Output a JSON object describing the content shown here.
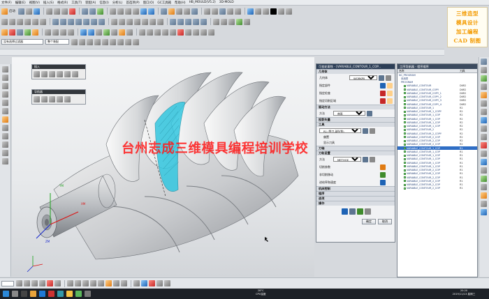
{
  "menus": [
    "文件(F)",
    "编辑(E)",
    "视图(V)",
    "插入(S)",
    "格式(R)",
    "工具(T)",
    "装配(A)",
    "信息(I)",
    "分析(L)",
    "首选项(P)",
    "窗口(O)",
    "GC工具箱",
    "帮助(H)",
    "HB_MOULD(V5.2)",
    "3D-MOLD"
  ],
  "toolbar": {
    "start_label": "启动",
    "filter_label": "没有选择过滤器",
    "assembly_combo": "整个装配"
  },
  "banner": {
    "line1": "三维造型",
    "line2": "模具设计",
    "line3": "加工编程",
    "line4": "CAD 制图"
  },
  "panels": {
    "insert": "插入",
    "navigator": "导航器"
  },
  "watermark": "台州志成三维模具编程培训学校",
  "csys": {
    "x_label": "XM",
    "y_label": "YM",
    "z_label": "ZM"
  },
  "dialog": {
    "title": "可变轮廓铣 - [VARIABLE_CONTOUR_1_COP...",
    "sec_geometry": "几何体",
    "geometry_label": "几何体",
    "geometry_value": "WORKPIECE",
    "part_label": "指定部件",
    "check_label": "指定检查",
    "cut_area_label": "指定切削区域",
    "sec_drive": "驱动方法",
    "method_label": "方法",
    "method_value": "曲面",
    "sec_projection": "投影矢量",
    "sec_tool": "工具",
    "tool_value": "R1 (铣刀-球头铣)",
    "offset_label": "偏置",
    "display_label": "显示刀具",
    "sec_axis": "刀轴",
    "sec_path": "刀轨设置",
    "path_method_label": "方法",
    "path_method_value": "METHOD",
    "cut_param_label": "切削参数",
    "non_cut_label": "非切削移动",
    "feed_label": "进给率和速度",
    "sec_machine": "机床控制",
    "sec_program": "程序",
    "sec_options": "选项",
    "sec_actions": "操作",
    "ok_label": "确定",
    "cancel_label": "取消"
  },
  "navigator": {
    "title": "工序导航器 - 程序顺序",
    "col_name": "名称",
    "col_tool": "刀具",
    "rows": [
      {
        "name": "NC_PROGRAM",
        "tool": ""
      },
      {
        "name": "未用项",
        "tool": ""
      },
      {
        "name": "PROGRAM",
        "tool": ""
      },
      {
        "name": "VARIABLE_CONTOUR",
        "tool": "D6R2"
      },
      {
        "name": "VARIABLE_CONTOUR_COPY",
        "tool": "D6R2"
      },
      {
        "name": "VARIABLE_CONTOUR_COPY_1",
        "tool": "D6R2"
      },
      {
        "name": "VARIABLE_CONTOUR_COPY_2",
        "tool": "D6R2"
      },
      {
        "name": "VARIABLE_CONTOUR_COPY_3",
        "tool": "D6R2"
      },
      {
        "name": "VARIABLE_CONTOUR_COPY_4",
        "tool": "D6R2"
      },
      {
        "name": "VARIABLE_CONTOUR_1",
        "tool": "R2"
      },
      {
        "name": "VARIABLE_CONTOUR_1_COPY",
        "tool": "R2"
      },
      {
        "name": "VARIABLE_CONTOUR_1_COP",
        "tool": "R2"
      },
      {
        "name": "VARIABLE_CONTOUR_1_COP",
        "tool": "R2"
      },
      {
        "name": "VARIABLE_CONTOUR_1_COP",
        "tool": "R2"
      },
      {
        "name": "VARIABLE_CONTOUR_1_COP",
        "tool": "R2"
      },
      {
        "name": "VARIABLE_CONTOUR_2",
        "tool": "R2"
      },
      {
        "name": "VARIABLE_CONTOUR_2_COPY",
        "tool": "R2"
      },
      {
        "name": "VARIABLE_CONTOUR_2_COP",
        "tool": "R2"
      },
      {
        "name": "VARIABLE_CONTOUR_2_COP",
        "tool": "R2"
      },
      {
        "name": "VARIABLE_CONTOUR_2_COP",
        "tool": "R2"
      },
      {
        "name": "VARIABLE_CONTOUR_1_COP",
        "tool": "R1"
      },
      {
        "name": "VARIABLE_CONTOUR_1_COP",
        "tool": "R1"
      },
      {
        "name": "VARIABLE_CONTOUR_1_COP",
        "tool": "R1"
      },
      {
        "name": "VARIABLE_CONTOUR_1_COP",
        "tool": "R1"
      },
      {
        "name": "VARIABLE_CONTOUR_1_COP",
        "tool": "R1"
      },
      {
        "name": "VARIABLE_CONTOUR_1_COP",
        "tool": "R1"
      },
      {
        "name": "VARIABLE_CONTOUR_2_COP",
        "tool": "R1"
      },
      {
        "name": "VARIABLE_CONTOUR_2_COP",
        "tool": "R1"
      },
      {
        "name": "VARIABLE_CONTOUR_2_COP",
        "tool": "R1"
      },
      {
        "name": "VARIABLE_CONTOUR_2_COP",
        "tool": "R1"
      },
      {
        "name": "VARIABLE_CONTOUR_2_COP",
        "tool": "R1"
      },
      {
        "name": "VARIABLE_CONTOUR_2_COP",
        "tool": "R1"
      }
    ]
  },
  "taskbar": {
    "weather": "28°C",
    "cpu_label": "CPU温度",
    "time": "20:20",
    "date": "2019/11/13 星期三"
  },
  "colors": {
    "accent": "#2f6ec5",
    "watermark": "#ff1d1d",
    "banner_text": "#f39a00",
    "toolpath": "#33c7e0"
  }
}
